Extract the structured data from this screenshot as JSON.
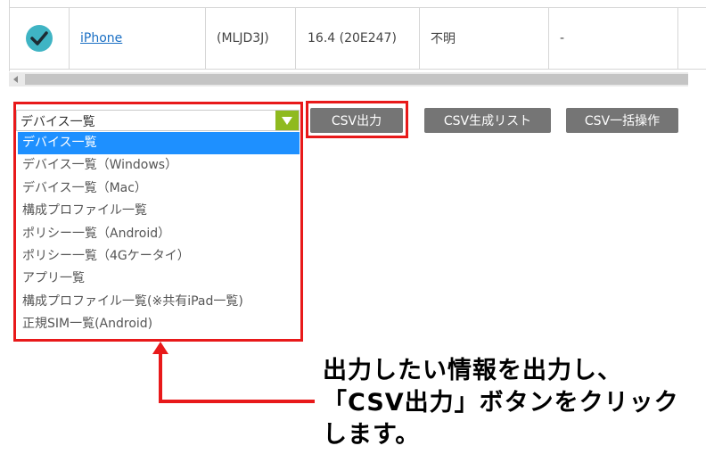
{
  "table": {
    "row": {
      "link_text": "iPhone",
      "model": "(MLJD3J)",
      "os_version": "16.4 (20E247)",
      "status": "不明",
      "extra": "-"
    }
  },
  "select": {
    "value": "デバイス一覧",
    "options": [
      "デバイス一覧",
      "デバイス一覧（Windows）",
      "デバイス一覧（Mac）",
      "構成プロファイル一覧",
      "ポリシー一覧（Android）",
      "ポリシー一覧（4Gケータイ）",
      "アプリ一覧",
      "構成プロファイル一覧(※共有iPad一覧)",
      "正規SIM一覧(Android)"
    ],
    "selected_index": 0
  },
  "buttons": {
    "csv_output": "CSV出力",
    "csv_list": "CSV生成リスト",
    "csv_bulk": "CSV一括操作"
  },
  "callout": {
    "line1": "出力したい情報を出力し、",
    "line2": "「CSV出力」ボタンをクリック",
    "line3": "します。"
  },
  "colors": {
    "highlight": "#e8191a",
    "check": "#3fb4c4",
    "select_arrow": "#8fba1f",
    "selected_option": "#1e90ff",
    "button": "#757575"
  }
}
